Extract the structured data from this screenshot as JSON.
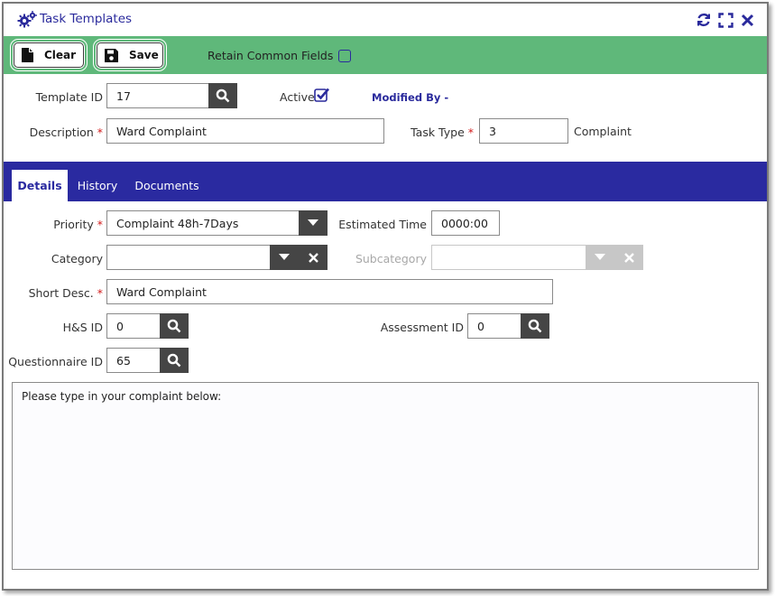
{
  "window": {
    "title": "Task Templates"
  },
  "icons": {
    "title": "gears-icon",
    "refresh": "refresh-icon",
    "maximize": "expand-icon",
    "close": "close-icon"
  },
  "colors": {
    "accent": "#2a2aa0",
    "toolbar": "#5fb87a",
    "required": "#d21c1c",
    "button_dark": "#454545"
  },
  "toolbar": {
    "clear_label": "Clear",
    "save_label": "Save",
    "retain_label": "Retain Common Fields"
  },
  "header": {
    "template_id_label": "Template ID",
    "template_id_value": "17",
    "active_label": "Active",
    "modified_by_label": "Modified By -",
    "description_label": "Description",
    "description_value": "Ward Complaint",
    "task_type_label": "Task Type",
    "task_type_value": "3",
    "task_type_name": "Complaint",
    "required_mark": "*"
  },
  "tabs": [
    {
      "label": "Details"
    },
    {
      "label": "History"
    },
    {
      "label": "Documents"
    }
  ],
  "details": {
    "priority_label": "Priority",
    "priority_value": "Complaint 48h-7Days",
    "estimated_time_label": "Estimated Time",
    "estimated_time_value": "0000:00",
    "category_label": "Category",
    "category_value": "",
    "subcategory_label": "Subcategory",
    "subcategory_value": "",
    "short_desc_label": "Short Desc.",
    "short_desc_value": "Ward Complaint",
    "hs_id_label": "H&S ID",
    "hs_id_value": "0",
    "assessment_id_label": "Assessment ID",
    "assessment_id_value": "0",
    "questionnaire_id_label": "Questionnaire ID",
    "questionnaire_id_value": "65",
    "body_text": "Please type in your complaint below:"
  }
}
